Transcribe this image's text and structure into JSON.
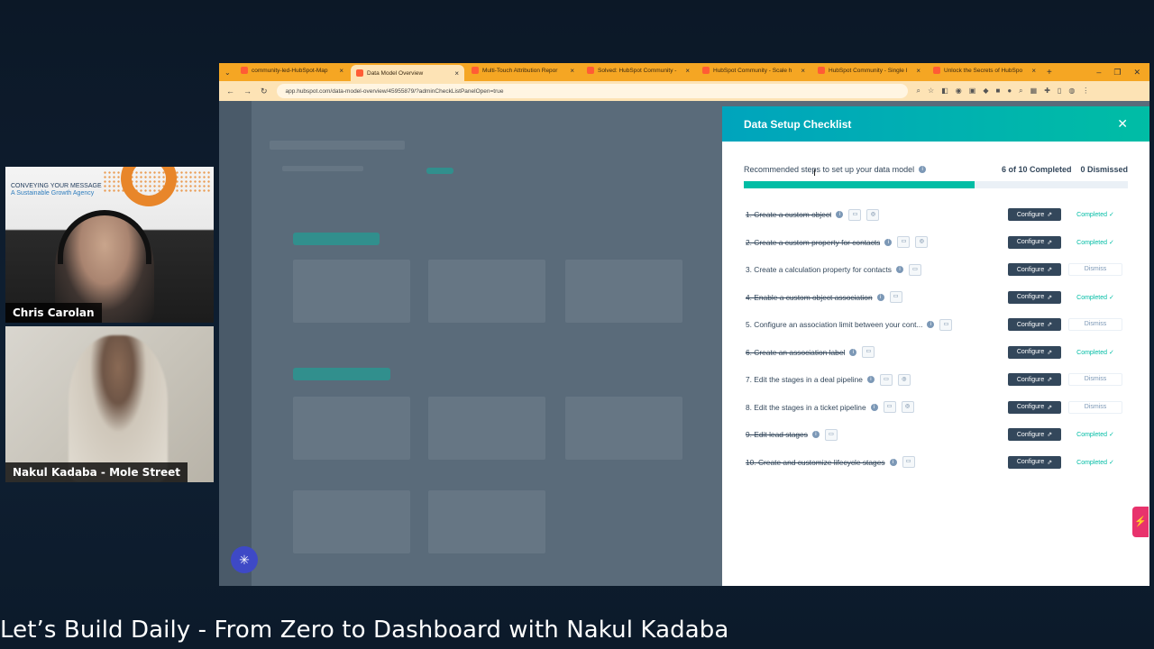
{
  "stream": {
    "lower_title": "Let’s Build Daily - From Zero to Dashboard with Nakul Kadaba",
    "cam1": {
      "name": "Chris Carolan",
      "logo_line1": "CONVEYING YOUR MESSAGE",
      "logo_line2": "A Sustainable Growth Agency"
    },
    "cam2": {
      "name": "Nakul Kadaba - Mole Street"
    }
  },
  "browser": {
    "tabs": [
      {
        "title": "community-led-HubSpot-Map",
        "active": false
      },
      {
        "title": "Data Model Overview",
        "active": true
      },
      {
        "title": "Multi-Touch Attribution Repor",
        "active": false
      },
      {
        "title": "Solved: HubSpot Community -",
        "active": false
      },
      {
        "title": "HubSpot Community - Scale h",
        "active": false
      },
      {
        "title": "HubSpot Community - Single I",
        "active": false
      },
      {
        "title": "Unlock the Secrets of HubSpo",
        "active": false
      }
    ],
    "url": "app.hubspot.com/data-model-overview/45955879/?adminCheckListPanelOpen=true"
  },
  "panel": {
    "title": "Data Setup Checklist",
    "subtitle": "Recommended steps to set up your data model",
    "completed_text": "6 of 10 Completed",
    "dismissed_text": "0 Dismissed",
    "progress_fraction": 0.6,
    "configure_label": "Configure",
    "completed_label": "Completed ✓",
    "dismiss_label": "Dismiss",
    "items": [
      {
        "label": "1. Create a custom object",
        "done": true,
        "icons": 2
      },
      {
        "label": "2. Create a custom property for contacts",
        "done": true,
        "icons": 2
      },
      {
        "label": "3. Create a calculation property for contacts",
        "done": false,
        "icons": 1
      },
      {
        "label": "4. Enable a custom object association",
        "done": true,
        "icons": 1
      },
      {
        "label": "5. Configure an association limit between your cont...",
        "done": false,
        "icons": 1
      },
      {
        "label": "6. Create an association label",
        "done": true,
        "icons": 1
      },
      {
        "label": "7. Edit the stages in a deal pipeline",
        "done": false,
        "icons": 2
      },
      {
        "label": "8. Edit the stages in a ticket pipeline",
        "done": false,
        "icons": 2
      },
      {
        "label": "9. Edit lead stages",
        "done": true,
        "icons": 1
      },
      {
        "label": "10. Create and customize lifecycle stages",
        "done": true,
        "icons": 1
      }
    ]
  },
  "colors": {
    "accent": "#00bda5",
    "header_start": "#00a4bd",
    "tabbar": "#f5a623",
    "button": "#33475b"
  }
}
